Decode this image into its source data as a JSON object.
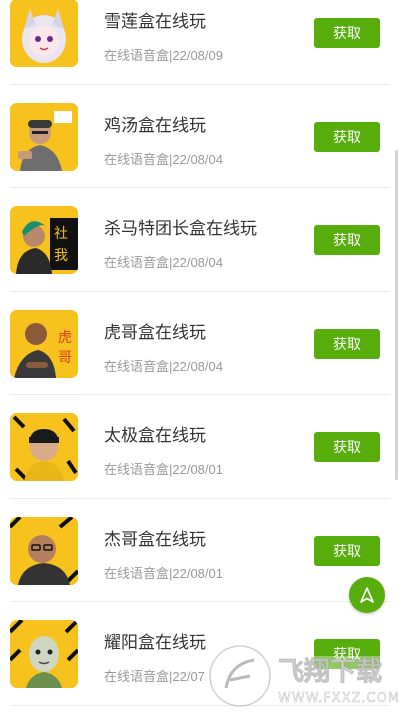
{
  "items": [
    {
      "title": "雪莲盒在线玩",
      "meta": "在线语音盒|22/08/09",
      "button": "获取",
      "art": "anime-girl"
    },
    {
      "title": "鸡汤盒在线玩",
      "meta": "在线语音盒|22/08/04",
      "button": "获取",
      "art": "man-cap"
    },
    {
      "title": "杀马特团长盒在线玩",
      "meta": "在线语音盒|22/08/04",
      "button": "获取",
      "art": "man-green-hair"
    },
    {
      "title": "虎哥盒在线玩",
      "meta": "在线语音盒|22/08/04",
      "button": "获取",
      "art": "man-crouch"
    },
    {
      "title": "太极盒在线玩",
      "meta": "在线语音盒|22/08/01",
      "button": "获取",
      "art": "man-bowl-cut"
    },
    {
      "title": "杰哥盒在线玩",
      "meta": "在线语音盒|22/08/01",
      "button": "获取",
      "art": "man-glasses"
    },
    {
      "title": "耀阳盒在线玩",
      "meta": "在线语音盒|22/07",
      "button": "获取",
      "art": "cartoon-head"
    }
  ],
  "watermark": {
    "brand": "飞翔下载",
    "url": "WWW.FXXZ.COM"
  },
  "colors": {
    "accent": "#56ad0b",
    "title": "#333333",
    "meta": "#9a9a9a",
    "thumb_bg": "#f7c21d"
  }
}
